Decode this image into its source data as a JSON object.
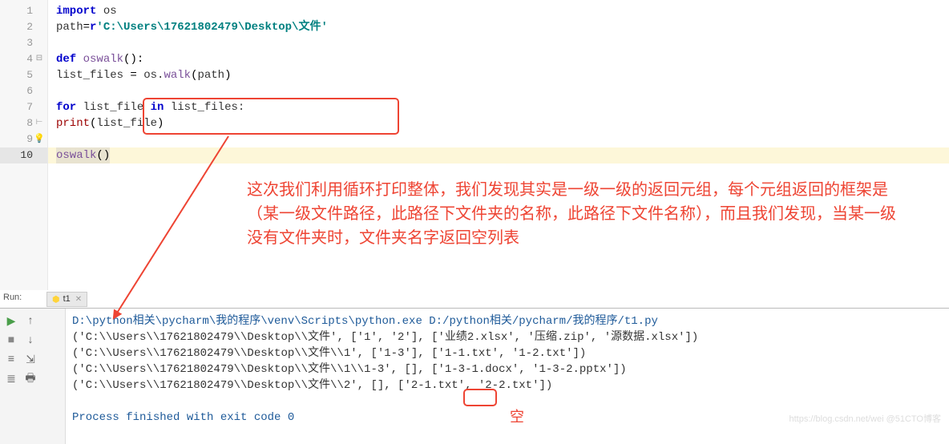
{
  "editor": {
    "line_numbers": [
      "1",
      "2",
      "3",
      "4",
      "5",
      "6",
      "7",
      "8",
      "9",
      "10"
    ],
    "current_line": 10,
    "lines": {
      "l1": {
        "kw": "import",
        "sp": " ",
        "mod": "os"
      },
      "l2": {
        "ident": "path",
        "op": "=",
        "prefix": "r",
        "str": "'C:\\Users\\17621802479\\Desktop\\文件'"
      },
      "l4": {
        "kw": "def",
        "sp": " ",
        "name": "oswalk",
        "paren": "():"
      },
      "l5": {
        "indent": "    ",
        "ident": "list_files",
        "sp": " ",
        "op": "=",
        "sp2": " ",
        "obj": "os",
        "dot": ".",
        "method": "walk",
        "open": "(",
        "arg": "path",
        "close": ")"
      },
      "l7": {
        "indent": "    ",
        "kw": "for",
        "sp": " ",
        "var": "list_file",
        "sp2": " ",
        "kw2": "in",
        "sp3": " ",
        "iter": "list_files",
        "colon": ":"
      },
      "l8": {
        "indent": "        ",
        "fn": "print",
        "open": "(",
        "arg": "list_file",
        "close": ")"
      },
      "l10": {
        "name": "oswalk",
        "paren": "()"
      }
    }
  },
  "annotation": {
    "text": "这次我们利用循环打印整体，我们发现其实是一级一级的返回元组，每个元组返回的框架是（某一级文件路径，此路径下文件夹的名称，此路径下文件名称），而且我们发现，当某一级没有文件夹时，文件夹名字返回空列表",
    "empty_label": "空"
  },
  "run": {
    "label": "Run:",
    "tab": "t1",
    "exit_msg": "Process finished with exit code 0",
    "cmd": "D:\\python相关\\pycharm\\我的程序\\venv\\Scripts\\python.exe D:/python相关/pycharm/我的程序/t1.py",
    "output": [
      "('C:\\\\Users\\\\17621802479\\\\Desktop\\\\文件', ['1', '2'], ['业绩2.xlsx', '压缩.zip', '源数据.xlsx'])",
      "('C:\\\\Users\\\\17621802479\\\\Desktop\\\\文件\\\\1', ['1-3'], ['1-1.txt', '1-2.txt'])",
      "('C:\\\\Users\\\\17621802479\\\\Desktop\\\\文件\\\\1\\\\1-3', [], ['1-3-1.docx', '1-3-2.pptx'])",
      "('C:\\\\Users\\\\17621802479\\\\Desktop\\\\文件\\\\2', [], ['2-1.txt', '2-2.txt'])"
    ]
  },
  "watermark": "https://blog.csdn.net/wei @51CTO博客"
}
